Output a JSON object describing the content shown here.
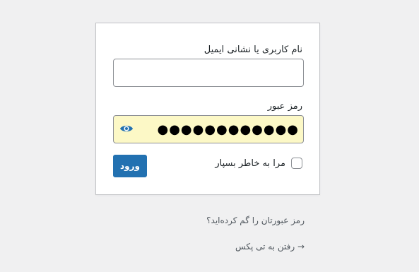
{
  "login_form": {
    "username_label": "نام کاربری یا نشانی ایمیل",
    "username_value": "",
    "password_label": "رمز عبور",
    "password_masked": "●●●●●●●●●●●●",
    "show_password_icon": "eye-icon",
    "remember_me_label": "مرا به خاطر بسپار",
    "remember_me_checked": false,
    "submit_label": "ورود"
  },
  "links": {
    "lost_password": "رمز عبورتان را گم کرده‌اید؟",
    "back_to_site": "→ رفتن به تی پکس"
  },
  "colors": {
    "background": "#f0f0f1",
    "primary_button": "#2271b1",
    "autofill_background": "#fcf8c6",
    "eye_icon": "#2271b1"
  }
}
